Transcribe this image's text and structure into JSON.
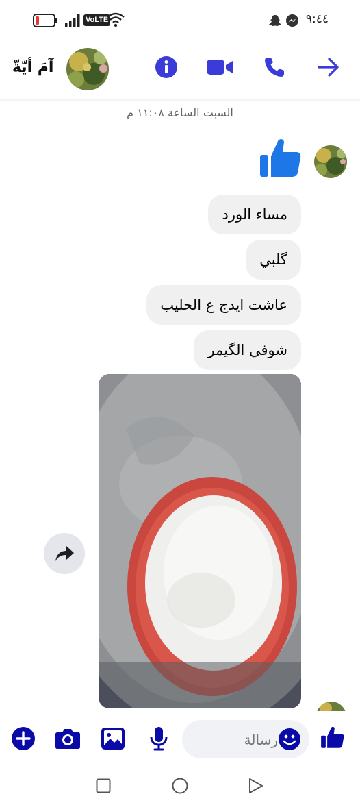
{
  "status_bar": {
    "time": "٩:٤٤",
    "network_badge": "VoLTE"
  },
  "header": {
    "contact_name": "آمَ أيّةّ",
    "icons": [
      "arrow-right-icon",
      "phone-icon",
      "video-icon",
      "info-icon"
    ]
  },
  "conversation": {
    "date_separator": "السبت الساعة ١١:٠٨ م",
    "messages": [
      "مساء الورد",
      "گلبي",
      "عاشت ايدج ع الحليب",
      "شوفي الگيمر"
    ]
  },
  "composer": {
    "placeholder": "رسالة"
  },
  "colors": {
    "accent": "#3b3bd9",
    "bubble_bg": "#f0f0f0",
    "thumb_blue": "#1e77e6"
  }
}
